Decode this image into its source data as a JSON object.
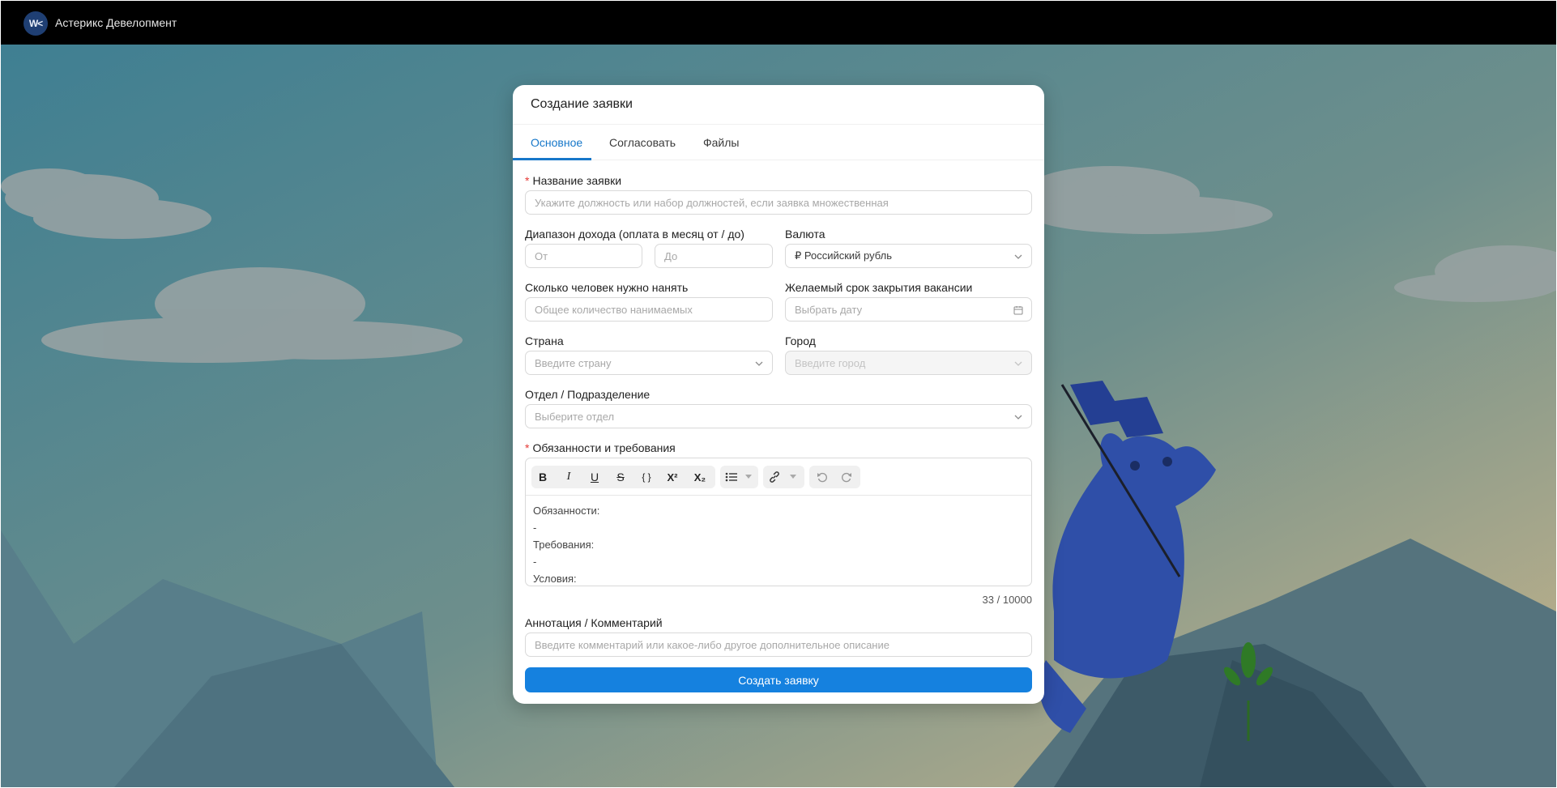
{
  "header": {
    "logo_text": "W<",
    "company": "Астерикс Девелопмент"
  },
  "modal": {
    "title": "Создание заявки",
    "tabs": [
      {
        "label": "Основное",
        "active": true
      },
      {
        "label": "Согласовать",
        "active": false
      },
      {
        "label": "Файлы",
        "active": false
      }
    ]
  },
  "form": {
    "title_field": {
      "label": "Название заявки",
      "required": true,
      "placeholder": "Укажите должность или набор должностей, если заявка множественная"
    },
    "income": {
      "label": "Диапазон дохода (оплата в месяц от / до)",
      "from_placeholder": "От",
      "to_placeholder": "До"
    },
    "currency": {
      "label": "Валюта",
      "value": "₽ Российский рубль"
    },
    "headcount": {
      "label": "Сколько человек нужно нанять",
      "placeholder": "Общее количество нанимаемых"
    },
    "deadline": {
      "label": "Желаемый срок закрытия вакансии",
      "placeholder": "Выбрать дату"
    },
    "country": {
      "label": "Страна",
      "placeholder": "Введите страну"
    },
    "city": {
      "label": "Город",
      "placeholder": "Введите город",
      "disabled": true
    },
    "department": {
      "label": "Отдел / Подразделение",
      "placeholder": "Выберите отдел"
    },
    "duties": {
      "label": "Обязанности и требования",
      "required": true,
      "toolbar": {
        "bold": "B",
        "italic": "I",
        "underline": "U",
        "strike": "S",
        "code": "{ }",
        "superscript": "X²",
        "subscript": "X₂"
      },
      "lines": [
        "Обязанности:",
        "-",
        "Требования:",
        "-",
        "Условия:"
      ],
      "counter": "33 / 10000"
    },
    "comment": {
      "label": "Аннотация / Комментарий",
      "placeholder": "Введите комментарий или какое-либо другое дополнительное описание"
    },
    "submit_label": "Создать заявку"
  },
  "colors": {
    "accent": "#1581df",
    "tab_active": "#1677c9",
    "required": "#e53935",
    "sky_top": "#3f7f92",
    "sky_bottom": "#c9b58a",
    "mascot": "#2f4fa8"
  },
  "icons": [
    "chevron-down-icon",
    "calendar-icon",
    "bullet-list-icon",
    "link-icon",
    "undo-icon",
    "redo-icon",
    "flag-icon"
  ]
}
